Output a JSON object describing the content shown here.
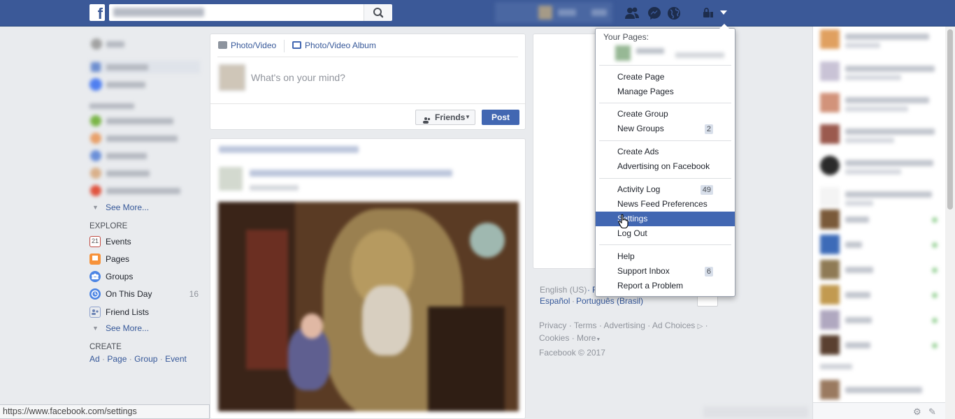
{
  "topbar": {
    "logo": "f",
    "search_icon": "search-icon",
    "friends_icon": "friend-requests-icon",
    "messages_icon": "messenger-icon",
    "notifications_icon": "globe-icon",
    "quickhelp_icon": "privacy-lock-icon",
    "menu_arrow_icon": "caret-down-icon"
  },
  "leftnav": {
    "see_more_1": "See More...",
    "explore_heading": "EXPLORE",
    "explore_items": [
      {
        "label": "Events",
        "icon": "calendar-icon",
        "icon_text": "21",
        "count": ""
      },
      {
        "label": "Pages",
        "icon": "flag-icon",
        "count": ""
      },
      {
        "label": "Groups",
        "icon": "groups-icon",
        "count": ""
      },
      {
        "label": "On This Day",
        "icon": "clock-icon",
        "count": "16"
      },
      {
        "label": "Friend Lists",
        "icon": "friend-list-icon",
        "count": ""
      }
    ],
    "see_more_2": "See More...",
    "create_heading": "CREATE",
    "create_links": [
      "Ad",
      "Page",
      "Group",
      "Event"
    ],
    "separator": "·"
  },
  "composer": {
    "photo_video": "Photo/Video",
    "photo_album": "Photo/Video Album",
    "placeholder": "What's on your mind?",
    "audience": "Friends",
    "post": "Post"
  },
  "dropdown": {
    "your_pages": "Your Pages:",
    "sections": [
      [
        {
          "label": "Create Page"
        },
        {
          "label": "Manage Pages"
        }
      ],
      [
        {
          "label": "Create Group"
        },
        {
          "label": "New Groups",
          "badge": "2"
        }
      ],
      [
        {
          "label": "Create Ads"
        },
        {
          "label": "Advertising on Facebook"
        }
      ],
      [
        {
          "label": "Activity Log",
          "badge": "49"
        },
        {
          "label": "News Feed Preferences"
        },
        {
          "label": "Settings",
          "highlighted": true
        },
        {
          "label": "Log Out"
        }
      ],
      [
        {
          "label": "Help"
        },
        {
          "label": "Support Inbox",
          "badge": "6"
        },
        {
          "label": "Report a Problem"
        }
      ]
    ]
  },
  "footer": {
    "lang_current": "English (US)",
    "lang_more": "F",
    "lang_es": "Español",
    "lang_pt": "Português (Brasil)",
    "links": [
      "Privacy",
      "Terms",
      "Advertising",
      "Ad Choices",
      "Cookies",
      "More"
    ],
    "copyright": "Facebook © 2017"
  },
  "statusbar": {
    "url": "https://www.facebook.com/settings"
  },
  "colors": {
    "brand": "#3b5998",
    "highlight": "#4267b2",
    "link": "#365899"
  }
}
